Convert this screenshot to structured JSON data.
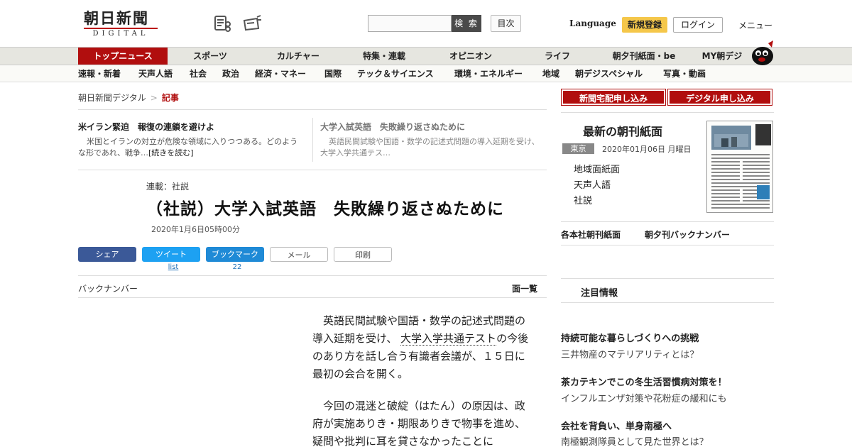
{
  "header": {
    "logo_main": "朝日新聞",
    "logo_sub": "DIGITAL",
    "search_button": "検 索",
    "toc_button": "目次",
    "language": "Language",
    "register": "新規登録",
    "login": "ログイン",
    "menu": "メニュー",
    "icons": [
      "newspaper-icon",
      "paper-delivery-icon"
    ]
  },
  "nav_primary": [
    "トップニュース",
    "スポーツ",
    "カルチャー",
    "特集・連載",
    "オピニオン",
    "ライフ",
    "朝夕刊紙面・be",
    "MY朝デジ"
  ],
  "nav_secondary": [
    "速報・新着",
    "天声人語",
    "社会",
    "政治",
    "経済・マネー",
    "国際",
    "テック＆サイエンス",
    "環境・エネルギー",
    "地域",
    "朝デジスペシャル",
    "写真・動画"
  ],
  "breadcrumb": {
    "home": "朝日新聞デジタル",
    "separator": ">",
    "current": "記事"
  },
  "related": [
    {
      "title": "米イラン緊迫　報復の連鎖を避けよ",
      "text": "米国とイランの対立が危険な領域に入りつつある。どのような形であれ、戦争…",
      "more": "[続きを読む]"
    },
    {
      "title": "大学入試英語　失敗繰り返さぬために",
      "text": "英語民間試験や国語・数学の記述式問題の導入延期を受け、大学入学共通テス…"
    }
  ],
  "article": {
    "series": "連載：社説",
    "headline": "（社説）大学入試英語　失敗繰り返さぬために",
    "date": "2020年1月6日05時00分",
    "paragraphs": [
      {
        "a": "英語民間試験や国語・数学の記述式問題の導入延期を受け、",
        "link": "大学入学共通テスト",
        "b": "の今後のあり方を話し合う有識者会議が、１５日に最初の会合を開く。"
      },
      {
        "a": "今回の混迷と破綻（はたん）の原因は、政府が実施ありき・期限ありきで物事を進め、疑問や批判に耳を貸さなかったことに",
        "link": "",
        "b": ""
      }
    ]
  },
  "share": {
    "facebook": "シェア",
    "twitter": "ツイート",
    "twitter_count": "list",
    "bookmark": "ブックマーク",
    "bookmark_count": "22",
    "mail": "メール",
    "print": "印刷"
  },
  "backnumber": "バックナンバー",
  "page_list": "面一覧",
  "sidebar": {
    "subscribe_home": "新聞宅配申し込み",
    "subscribe_digital": "デジタル申し込み",
    "paper_title": "最新の朝刊紙面",
    "region": "東京",
    "paper_date": "2020年01月06日 月曜日",
    "paper_links": [
      "地域面紙面",
      "天声人語",
      "社説"
    ],
    "link_honsha": "各本社朝刊紙面",
    "link_backnumber": "朝夕刊バックナンバー",
    "attention": "注目情報",
    "promos": [
      {
        "title": "持続可能な暮らしづくりへの挑戦",
        "sub": "三井物産のマテリアリティとは？"
      },
      {
        "title": "茶カテキンでこの冬生活習慣病対策を！",
        "sub": "インフルエンザ対策や花粉症の緩和にも"
      },
      {
        "title": "会社を背負い、単身南極へ",
        "sub": "南極観測隊員として見た世界とは？"
      }
    ]
  },
  "colors": {
    "accent": "#b10e0e",
    "register": "#f5c74a",
    "facebook": "#3b5998",
    "twitter": "#1da1f2"
  }
}
